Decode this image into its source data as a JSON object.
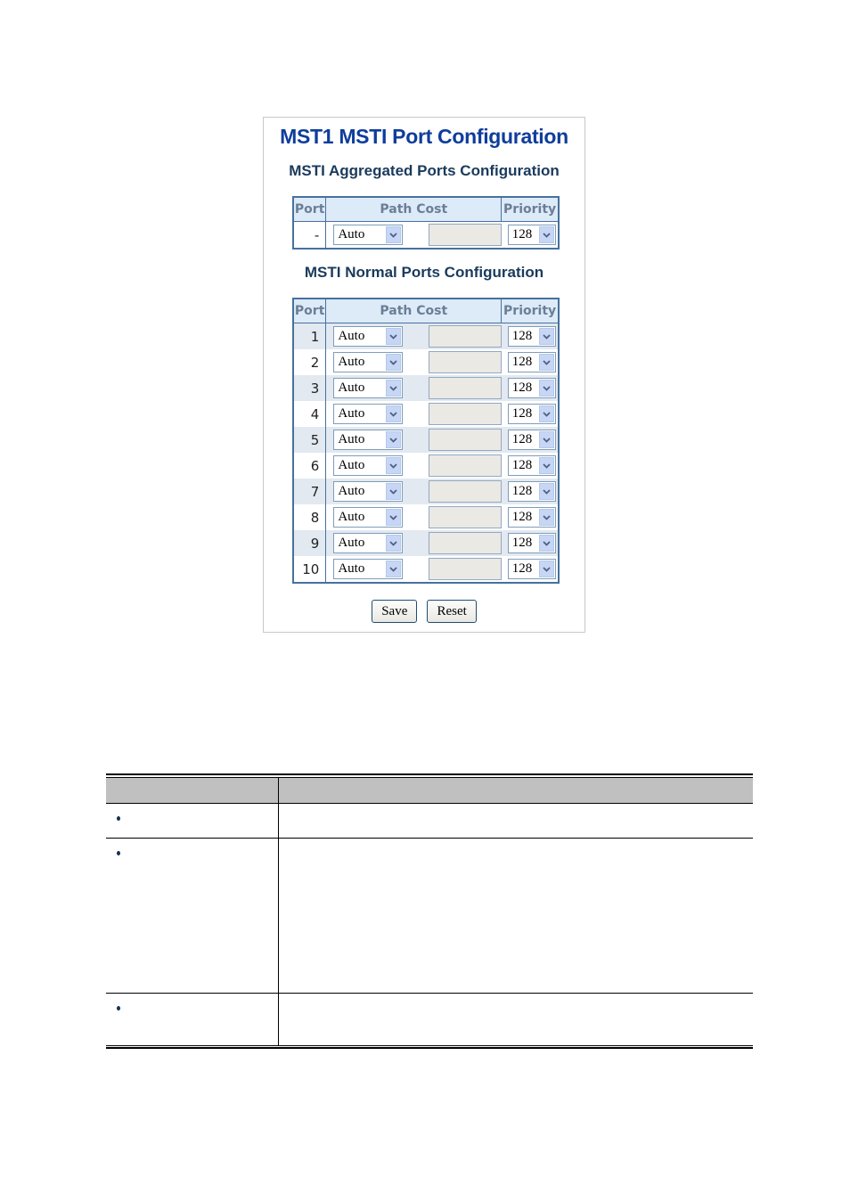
{
  "panel": {
    "title": "MST1 MSTI Port Configuration",
    "aggregated_section_title": "MSTI Aggregated Ports Configuration",
    "normal_section_title": "MSTI Normal Ports Configuration",
    "columns": {
      "port": "Port",
      "path_cost": "Path Cost",
      "priority": "Priority"
    },
    "aggregated_rows": [
      {
        "port": "-",
        "path_cost_mode": "Auto",
        "path_cost_value": "",
        "priority": "128"
      }
    ],
    "normal_rows": [
      {
        "port": "1",
        "path_cost_mode": "Auto",
        "path_cost_value": "",
        "priority": "128"
      },
      {
        "port": "2",
        "path_cost_mode": "Auto",
        "path_cost_value": "",
        "priority": "128"
      },
      {
        "port": "3",
        "path_cost_mode": "Auto",
        "path_cost_value": "",
        "priority": "128"
      },
      {
        "port": "4",
        "path_cost_mode": "Auto",
        "path_cost_value": "",
        "priority": "128"
      },
      {
        "port": "5",
        "path_cost_mode": "Auto",
        "path_cost_value": "",
        "priority": "128"
      },
      {
        "port": "6",
        "path_cost_mode": "Auto",
        "path_cost_value": "",
        "priority": "128"
      },
      {
        "port": "7",
        "path_cost_mode": "Auto",
        "path_cost_value": "",
        "priority": "128"
      },
      {
        "port": "8",
        "path_cost_mode": "Auto",
        "path_cost_value": "",
        "priority": "128"
      },
      {
        "port": "9",
        "path_cost_mode": "Auto",
        "path_cost_value": "",
        "priority": "128"
      },
      {
        "port": "10",
        "path_cost_mode": "Auto",
        "path_cost_value": "",
        "priority": "128"
      }
    ],
    "buttons": {
      "save": "Save",
      "reset": "Reset"
    }
  },
  "doc_table": {
    "header": [
      "",
      ""
    ],
    "rows": [
      {
        "bullet": "•",
        "object": "",
        "description": ""
      },
      {
        "bullet": "•",
        "object": "",
        "description": ""
      },
      {
        "bullet": "•",
        "object": "",
        "description": ""
      }
    ]
  },
  "colors": {
    "title": "#0e3d9b",
    "table_border": "#46719e",
    "header_bg": "#ddeaf8",
    "odd_row_bg": "#e3e9f1",
    "doc_header_bg": "#c0c0c0"
  },
  "icons": {
    "select_arrow": "chevron-down-icon"
  }
}
